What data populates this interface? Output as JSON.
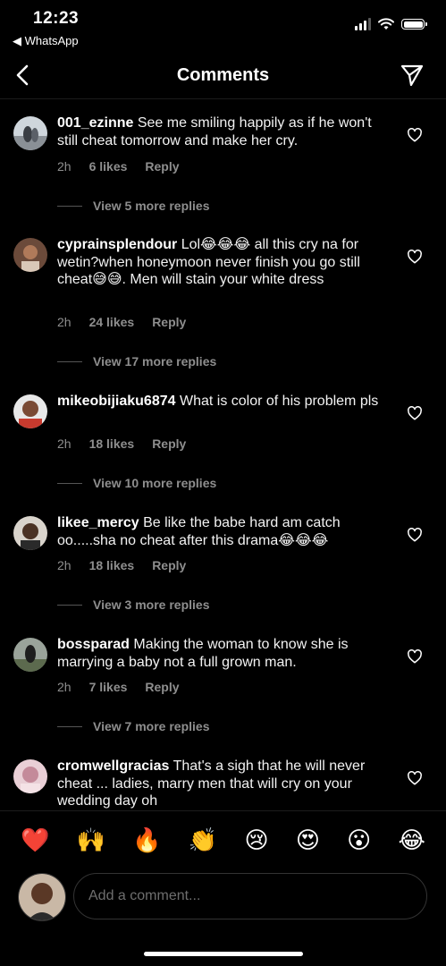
{
  "status_bar": {
    "time": "12:23",
    "back_app": "◀ WhatsApp"
  },
  "header": {
    "title": "Comments"
  },
  "comments": [
    {
      "username": "001_ezinne",
      "text": "See me smiling happily as if he won't still cheat tomorrow and make her cry.",
      "time": "2h",
      "likes": "6 likes",
      "reply": "Reply",
      "view_more": "View 5 more replies"
    },
    {
      "username": "cyprainsplendour",
      "text": "Lol😂😂😂 all this cry na for wetin?when honeymoon never finish you go still cheat😅😅. Men will stain your white dress",
      "time": "2h",
      "likes": "24 likes",
      "reply": "Reply",
      "view_more": "View 17 more replies"
    },
    {
      "username": "mikeobijiaku6874",
      "text": "What is color of his problem pls",
      "time": "2h",
      "likes": "18 likes",
      "reply": "Reply",
      "view_more": "View 10 more replies"
    },
    {
      "username": "likee_mercy",
      "text": "Be like the babe hard am catch oo.....sha no cheat after this drama😂😂😂",
      "time": "2h",
      "likes": "18 likes",
      "reply": "Reply",
      "view_more": "View 3 more replies"
    },
    {
      "username": "bossparad",
      "text": "Making the woman to know she is marrying a baby not a full grown man.",
      "time": "2h",
      "likes": "7 likes",
      "reply": "Reply",
      "view_more": "View 7 more replies"
    },
    {
      "username": "cromwellgracias",
      "text": "That's a sigh that he will never cheat ... ladies, marry men that will cry on your wedding day oh"
    }
  ],
  "reactions": [
    "❤️",
    "🙌",
    "🔥",
    "👏",
    "😢",
    "😍",
    "😮",
    "😂"
  ],
  "composer": {
    "placeholder": "Add a comment..."
  },
  "colors": {
    "background": "#000000",
    "muted": "#8e8e8e",
    "text": "#ffffff"
  }
}
